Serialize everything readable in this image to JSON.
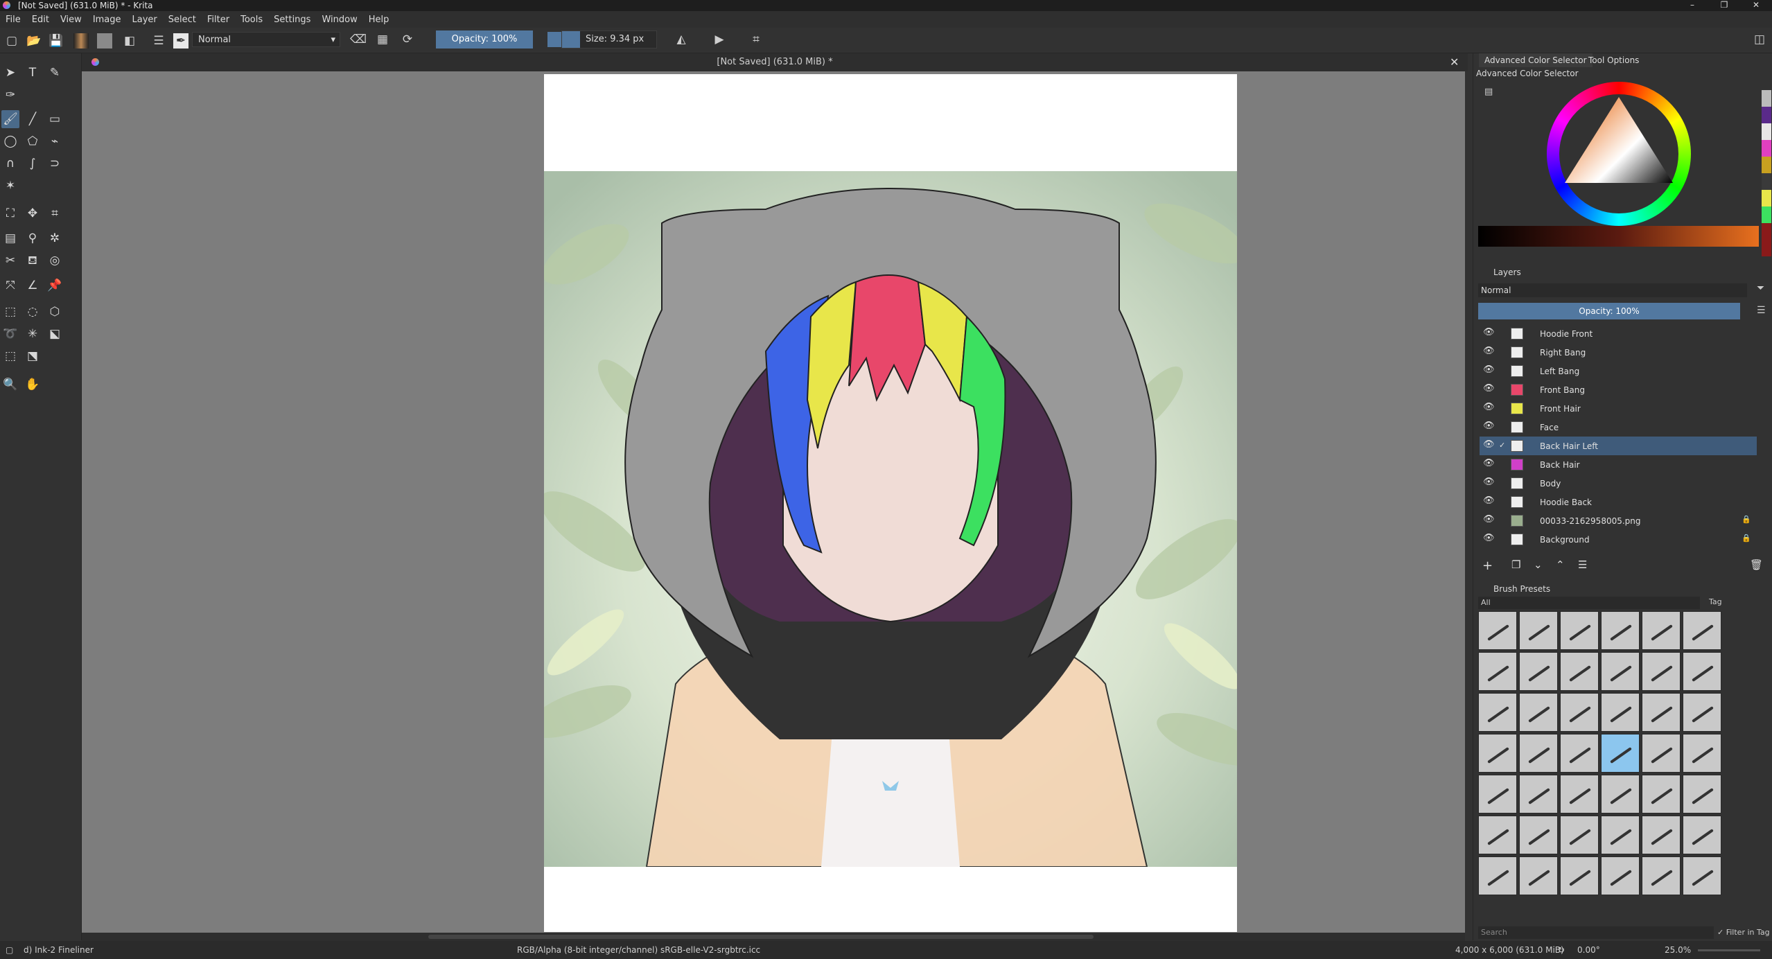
{
  "window": {
    "title": "[Not Saved]  (631.0 MiB) * - Krita",
    "controls": [
      "–",
      "❐",
      "✕"
    ]
  },
  "menu": [
    "File",
    "Edit",
    "View",
    "Image",
    "Layer",
    "Select",
    "Filter",
    "Tools",
    "Settings",
    "Window",
    "Help"
  ],
  "toolbar": {
    "blend_mode": "Normal",
    "opacity_label": "Opacity: 100%",
    "size_label": "Size: 9.34 px"
  },
  "document": {
    "tab_title": "[Not Saved]  (631.0 MiB) *"
  },
  "dock": {
    "tabs": [
      "Advanced Color Selector",
      "Tool Options"
    ],
    "color_selector_title": "Advanced Color Selector",
    "layers_title": "Layers",
    "layers_blend": "Normal",
    "layers_opacity": "Opacity:  100%",
    "brush_presets_title": "Brush Presets",
    "brush_filter": "All",
    "brush_tag": "Tag",
    "search_placeholder": "Search",
    "filter_in_tag": "Filter in Tag"
  },
  "layers": [
    {
      "name": "Hoodie Front",
      "locked": false
    },
    {
      "name": "Right Bang",
      "locked": false
    },
    {
      "name": "Left Bang",
      "locked": false
    },
    {
      "name": "Front Bang",
      "locked": false
    },
    {
      "name": "Front Hair",
      "locked": false
    },
    {
      "name": "Face",
      "locked": false
    },
    {
      "name": "Back Hair Left",
      "locked": false,
      "selected": true
    },
    {
      "name": "Back Hair",
      "locked": false
    },
    {
      "name": "Body",
      "locked": false
    },
    {
      "name": "Hoodie Back",
      "locked": false
    },
    {
      "name": "00033-2162958005.png",
      "locked": true
    },
    {
      "name": "Background",
      "locked": true
    }
  ],
  "status": {
    "brush_name": "d) Ink-2 Fineliner",
    "color_info": "RGB/Alpha (8-bit integer/channel)  sRGB-elle-V2-srgbtrc.icc",
    "dimensions": "4,000 x 6,000 (631.0 MiB)",
    "rotation": "0.00°",
    "zoom": "25.0%"
  },
  "colors": {
    "accent": "#5278a0",
    "hair_red": "#e8476a",
    "hair_yellow": "#e8e64a",
    "hair_blue": "#3d64e6",
    "hair_green": "#3ce060",
    "hood_gray": "#9a9a9a"
  }
}
